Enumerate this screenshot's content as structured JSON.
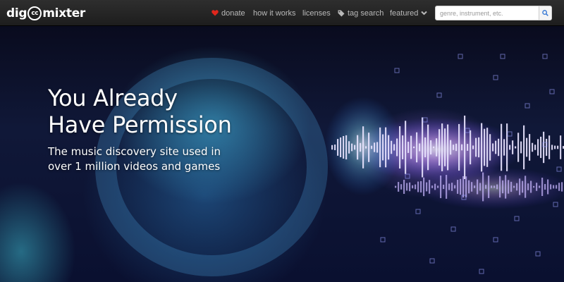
{
  "brand": {
    "prefix": "dig",
    "badge": "cc",
    "suffix": "mixter"
  },
  "nav": {
    "donate": "donate",
    "how_it_works": "how it works",
    "licenses": "licenses",
    "tag_search": "tag search",
    "featured": "featured"
  },
  "search": {
    "placeholder": "genre, instrument, etc."
  },
  "hero": {
    "headline_line1": "You Already",
    "headline_line2": "Have Permission",
    "subline_line1": "The music discovery site used in",
    "subline_line2": "over 1 million videos and games"
  },
  "icons": {
    "donate": "heart-icon",
    "tag_search": "tag-icon",
    "featured": "chevron-down-icon",
    "search": "search-icon"
  },
  "colors": {
    "navbar": "#262626",
    "heart": "#e0261c",
    "nav_text": "#b9b9b9",
    "search_icon": "#3a7bd5"
  }
}
